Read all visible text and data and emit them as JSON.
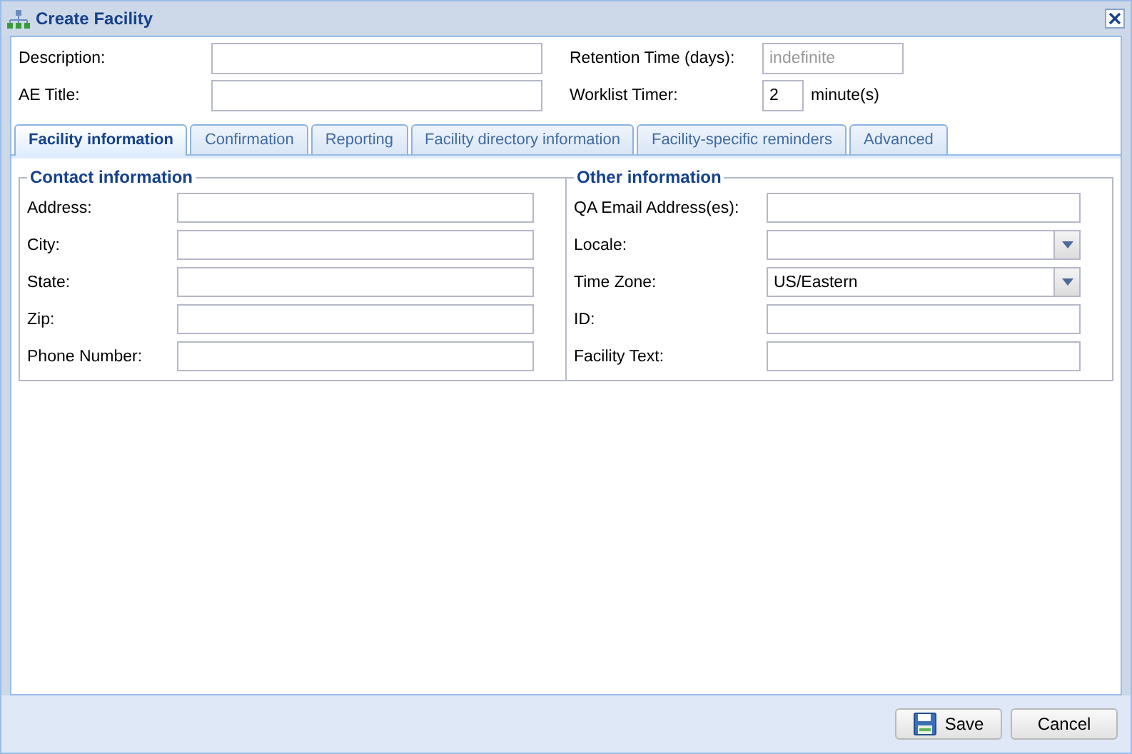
{
  "window": {
    "title": "Create Facility"
  },
  "header_fields": [
    {
      "label": "Description:"
    },
    {
      "label": "Retention Time (days):",
      "placeholder": "indefinite"
    },
    {
      "label": "AE Title:"
    },
    {
      "label": "Worklist Timer:",
      "value": "2",
      "unit": "minute(s)"
    }
  ],
  "tabs": [
    {
      "label": "Facility information",
      "selected": true
    },
    {
      "label": "Confirmation",
      "selected": false
    },
    {
      "label": "Reporting",
      "selected": false
    },
    {
      "label": "Facility directory information",
      "selected": false
    },
    {
      "label": "Facility-specific reminders",
      "selected": false
    },
    {
      "label": "Advanced",
      "selected": false
    }
  ],
  "sections": [
    {
      "title": "Contact information",
      "fields": [
        {
          "label": "Address:",
          "kind": "text"
        },
        {
          "label": "City:",
          "kind": "text"
        },
        {
          "label": "State:",
          "kind": "text"
        },
        {
          "label": "Zip:",
          "kind": "text"
        },
        {
          "label": "Phone Number:",
          "kind": "text"
        }
      ]
    },
    {
      "title": "Other information",
      "fields": [
        {
          "label": "QA Email Address(es):",
          "kind": "text"
        },
        {
          "label": "Locale:",
          "kind": "select"
        },
        {
          "label": "Time Zone:",
          "kind": "select",
          "value": "US/Eastern"
        },
        {
          "label": "ID:",
          "kind": "text"
        },
        {
          "label": "Facility Text:",
          "kind": "text"
        }
      ]
    }
  ],
  "buttons": [
    {
      "label": "Save",
      "kind": "save"
    },
    {
      "label": "Cancel",
      "kind": "plain"
    }
  ]
}
